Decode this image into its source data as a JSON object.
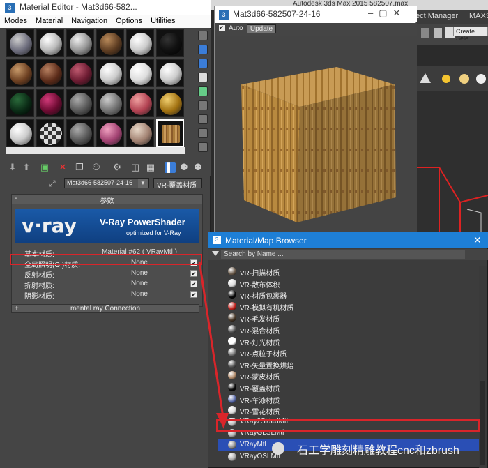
{
  "background_app": {
    "title": "Autodesk 3ds Max 2015    582507.max",
    "menu": [
      "ect Manager",
      "MAXS"
    ],
    "selection_set": "Create Sele"
  },
  "material_editor": {
    "title": "Material Editor - Mat3d66-582...",
    "menu": [
      "Modes",
      "Material",
      "Navigation",
      "Options",
      "Utilities"
    ],
    "material_name": "Mat3d66-582507-24-16",
    "material_type": "VR-覆盖材质",
    "params_title": "参数",
    "banner": {
      "logo": "v·ray",
      "title": "V-Ray PowerShader",
      "subtitle": "optimized for V-Ray"
    },
    "params": [
      {
        "label": "基本材质:",
        "value": "Material #62 ( VRayMtl )",
        "checked": null
      },
      {
        "label": "全局照明(GI)材质:",
        "value": "None",
        "checked": true
      },
      {
        "label": "反射材质:",
        "value": "None",
        "checked": true
      },
      {
        "label": "折射材质:",
        "value": "None",
        "checked": true
      },
      {
        "label": "阴影材质:",
        "value": "None",
        "checked": true
      }
    ],
    "mental_ray": "mental ray Connection"
  },
  "preview": {
    "title": "Mat3d66-582507-24-16",
    "auto_label": "Auto",
    "update_label": "Update"
  },
  "browser": {
    "title": "Material/Map Browser",
    "search_placeholder": "Search by Name ...",
    "items": [
      {
        "label": "VR-扫描材质",
        "color": "#6a5a4a"
      },
      {
        "label": "VR-散布体积",
        "color": "#d9d9d9"
      },
      {
        "label": "VR-材质包裹器",
        "color": "#0a0a0a"
      },
      {
        "label": "VR-模拟有机材质",
        "color": "#c0211b"
      },
      {
        "label": "VR-毛发材质",
        "color": "#4a3a2a"
      },
      {
        "label": "VR-混合材质",
        "color": "#5a5a5a"
      },
      {
        "label": "VR-灯光材质",
        "color": "#ffffff"
      },
      {
        "label": "VR-点粒子材质",
        "color": "#777777"
      },
      {
        "label": "VR-矢量置换烘焙",
        "color": "#555555"
      },
      {
        "label": "VR-蒙皮材质",
        "color": "#b08a6a"
      },
      {
        "label": "VR-覆盖材质",
        "color": "#0a0a0a"
      },
      {
        "label": "VR-车漆材质",
        "color": "#5a6aa8"
      },
      {
        "label": "VR-雪花材质",
        "color": "#d9d9d9"
      },
      {
        "label": "VRay2SidedMtl",
        "color": "#bbbbbb"
      },
      {
        "label": "VRayGLSLMtl",
        "color": "#aaaaaa"
      },
      {
        "label": "VRayMtl",
        "color": "#888888"
      },
      {
        "label": "VRayOSLMtl",
        "color": "#aaaaaa"
      }
    ],
    "selected_index": 15
  },
  "watermark": "石工学雕刻精雕教程cnc和zbrush"
}
